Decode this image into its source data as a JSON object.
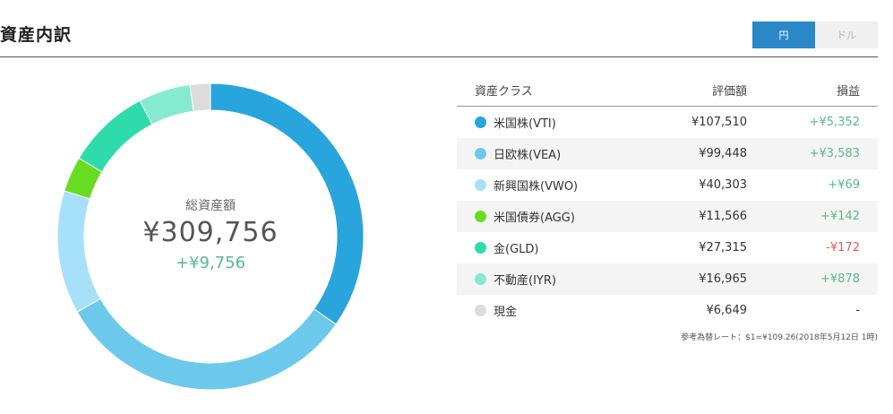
{
  "page": {
    "title": "資産内訳"
  },
  "currency_toggle": {
    "options": [
      "円",
      "ドル"
    ],
    "selected": "円"
  },
  "summary": {
    "label": "総資産額",
    "total": "¥309,756",
    "gain": "+¥9,756"
  },
  "table": {
    "headers": [
      "資産クラス",
      "評価額",
      "損益"
    ],
    "rows": [
      {
        "name": "米国株(VTI)",
        "value": "¥107,510",
        "gain": "+¥5,352",
        "gain_sign": "pos",
        "color": "#28a5dc"
      },
      {
        "name": "日欧株(VEA)",
        "value": "¥99,448",
        "gain": "+¥3,583",
        "gain_sign": "pos",
        "color": "#6cc9ec"
      },
      {
        "name": "新興国株(VWO)",
        "value": "¥40,303",
        "gain": "+¥69",
        "gain_sign": "pos",
        "color": "#a6e1f9"
      },
      {
        "name": "米国債券(AGG)",
        "value": "¥11,566",
        "gain": "+¥142",
        "gain_sign": "pos",
        "color": "#66dd21"
      },
      {
        "name": "金(GLD)",
        "value": "¥27,315",
        "gain": "-¥172",
        "gain_sign": "neg",
        "color": "#2edcab"
      },
      {
        "name": "不動産(IYR)",
        "value": "¥16,965",
        "gain": "+¥878",
        "gain_sign": "pos",
        "color": "#85ead0"
      },
      {
        "name": "現金",
        "value": "¥6,649",
        "gain": "-",
        "gain_sign": "neu",
        "color": "#dcdcdc"
      }
    ]
  },
  "exchange_note": "参考為替レート：$1=¥109.26(2018年5月12日 1時)",
  "chart_data": {
    "type": "pie",
    "categories": [
      "米国株(VTI)",
      "日欧株(VEA)",
      "新興国株(VWO)",
      "米国債券(AGG)",
      "金(GLD)",
      "不動産(IYR)",
      "現金"
    ],
    "values": [
      107510,
      99448,
      40303,
      11566,
      27315,
      16965,
      6649
    ],
    "colors": [
      "#28a5dc",
      "#6cc9ec",
      "#a6e1f9",
      "#66dd21",
      "#2edcab",
      "#85ead0",
      "#dcdcdc"
    ],
    "title": "総資産額",
    "donut": true
  }
}
